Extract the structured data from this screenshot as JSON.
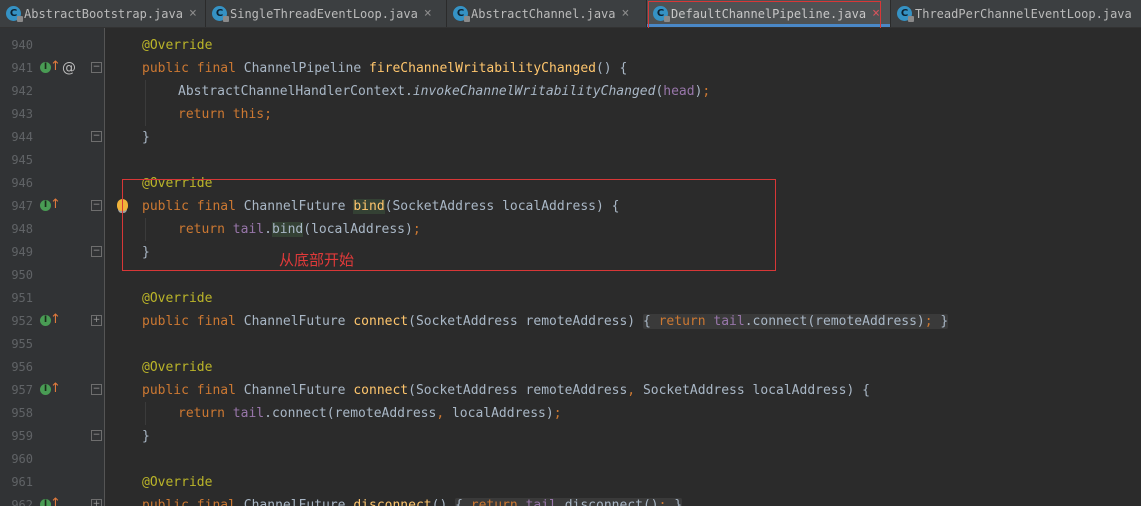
{
  "tabs": [
    {
      "label": "AbstractBootstrap.java",
      "active": false
    },
    {
      "label": "SingleThreadEventLoop.java",
      "active": false
    },
    {
      "label": "AbstractChannel.java",
      "active": false
    },
    {
      "label": "DefaultChannelPipeline.java",
      "active": true
    },
    {
      "label": "ThreadPerChannelEventLoop.java",
      "active": false
    }
  ],
  "tab_icon_letter": "C",
  "tab_close_glyph": "×",
  "gutter_icons": {
    "implements": "implementing-method-icon",
    "overrides": "override-up-arrow-icon",
    "at": "@",
    "bulb": "lightbulb-icon"
  },
  "lines": [
    {
      "num": "940"
    },
    {
      "num": "941"
    },
    {
      "num": "942"
    },
    {
      "num": "943"
    },
    {
      "num": "944"
    },
    {
      "num": "945"
    },
    {
      "num": "946"
    },
    {
      "num": "947"
    },
    {
      "num": "948"
    },
    {
      "num": "949"
    },
    {
      "num": "950"
    },
    {
      "num": "951"
    },
    {
      "num": "952"
    },
    {
      "num": "955"
    },
    {
      "num": "956"
    },
    {
      "num": "957"
    },
    {
      "num": "958"
    },
    {
      "num": "959"
    },
    {
      "num": "960"
    },
    {
      "num": "961"
    },
    {
      "num": "962"
    }
  ],
  "code": {
    "override": "@Override",
    "public": "public",
    "final": "final",
    "return": "return",
    "this": "this",
    "ChannelPipeline": "ChannelPipeline",
    "ChannelFuture": "ChannelFuture",
    "fireChannelWritabilityChanged": "fireChannelWritabilityChanged",
    "AbstractChannelHandlerContext": "AbstractChannelHandlerContext",
    "invokeChannelWritabilityChanged": "invokeChannelWritabilityChanged",
    "head": "head",
    "tail": "tail",
    "bind": "bind",
    "connect": "connect",
    "disconnect": "disconnect",
    "SocketAddress": "SocketAddress",
    "localAddress": "localAddress",
    "remoteAddress": "remoteAddress"
  },
  "annotation_note": "从底部开始",
  "colors": {
    "background": "#2b2b2b",
    "keyword": "#cc7832",
    "annotation": "#bbb529",
    "method": "#ffc66d",
    "field": "#9876aa",
    "text": "#a9b7c6",
    "highlight_box": "#d83737"
  }
}
